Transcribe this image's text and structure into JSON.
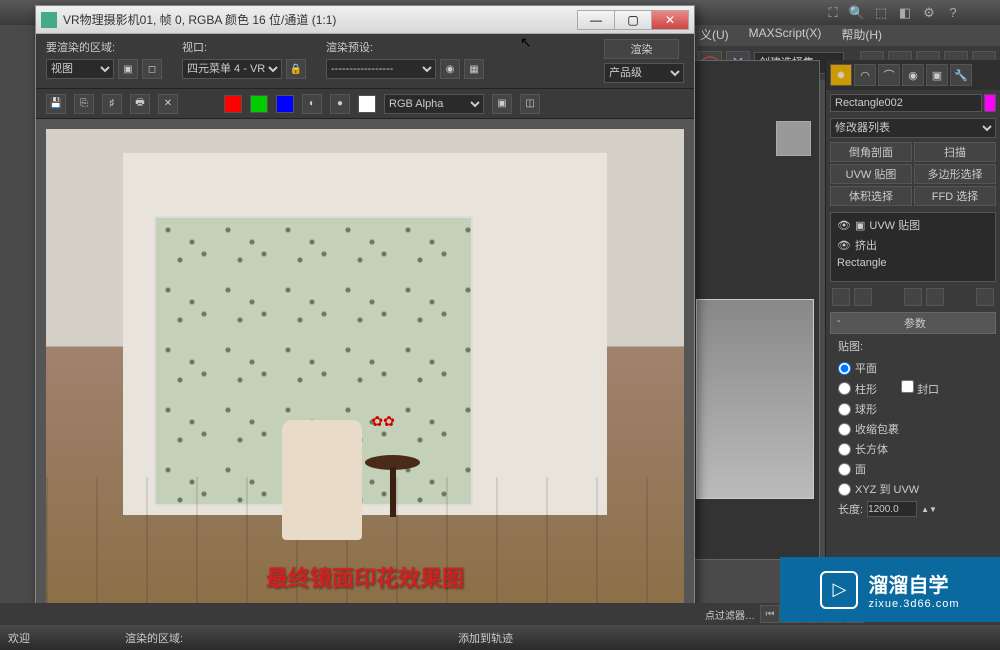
{
  "menu": {
    "items": [
      "义(U)",
      "MAXScript(X)",
      "帮助(H)"
    ],
    "select_set": "创建选择集"
  },
  "rfb": {
    "title": "VR物理摄影机01, 帧 0, RGBA 颜色 16 位/通道 (1:1)",
    "labels": {
      "area": "要渲染的区域:",
      "viewport": "视口:",
      "preset": "渲染预设:",
      "render": "渲染"
    },
    "area_select": "视图",
    "viewport_select": "四元菜单 4 - VR‡",
    "preset_select": "-----------------",
    "production": "产品级",
    "channel_select": "RGB Alpha",
    "caption": "最终镜面印花效果图"
  },
  "right": {
    "obj_name": "Rectangle002",
    "modlist": "修改器列表",
    "mods": [
      "倒角剖面",
      "扫描",
      "UVW 贴图",
      "多边形选择",
      "体积选择",
      "FFD 选择"
    ],
    "stack": [
      "UVW 贴图",
      "挤出",
      "Rectangle"
    ],
    "rollout_title": "参数",
    "map_label": "贴图:",
    "map_types": [
      "平面",
      "柱形",
      "球形",
      "收缩包裹",
      "长方体",
      "面",
      "XYZ 到 UVW"
    ],
    "cap": "封口",
    "length_label": "长度:",
    "length_value": "1200.0"
  },
  "timeline": {
    "filter_label": "点过滤器…"
  },
  "status": {
    "welcome": "欢迎",
    "render_area": "渲染的区域:",
    "add_to": "添加到轨迹"
  },
  "watermark": {
    "big": "溜溜自学",
    "small": "zixue.3d66.com"
  }
}
